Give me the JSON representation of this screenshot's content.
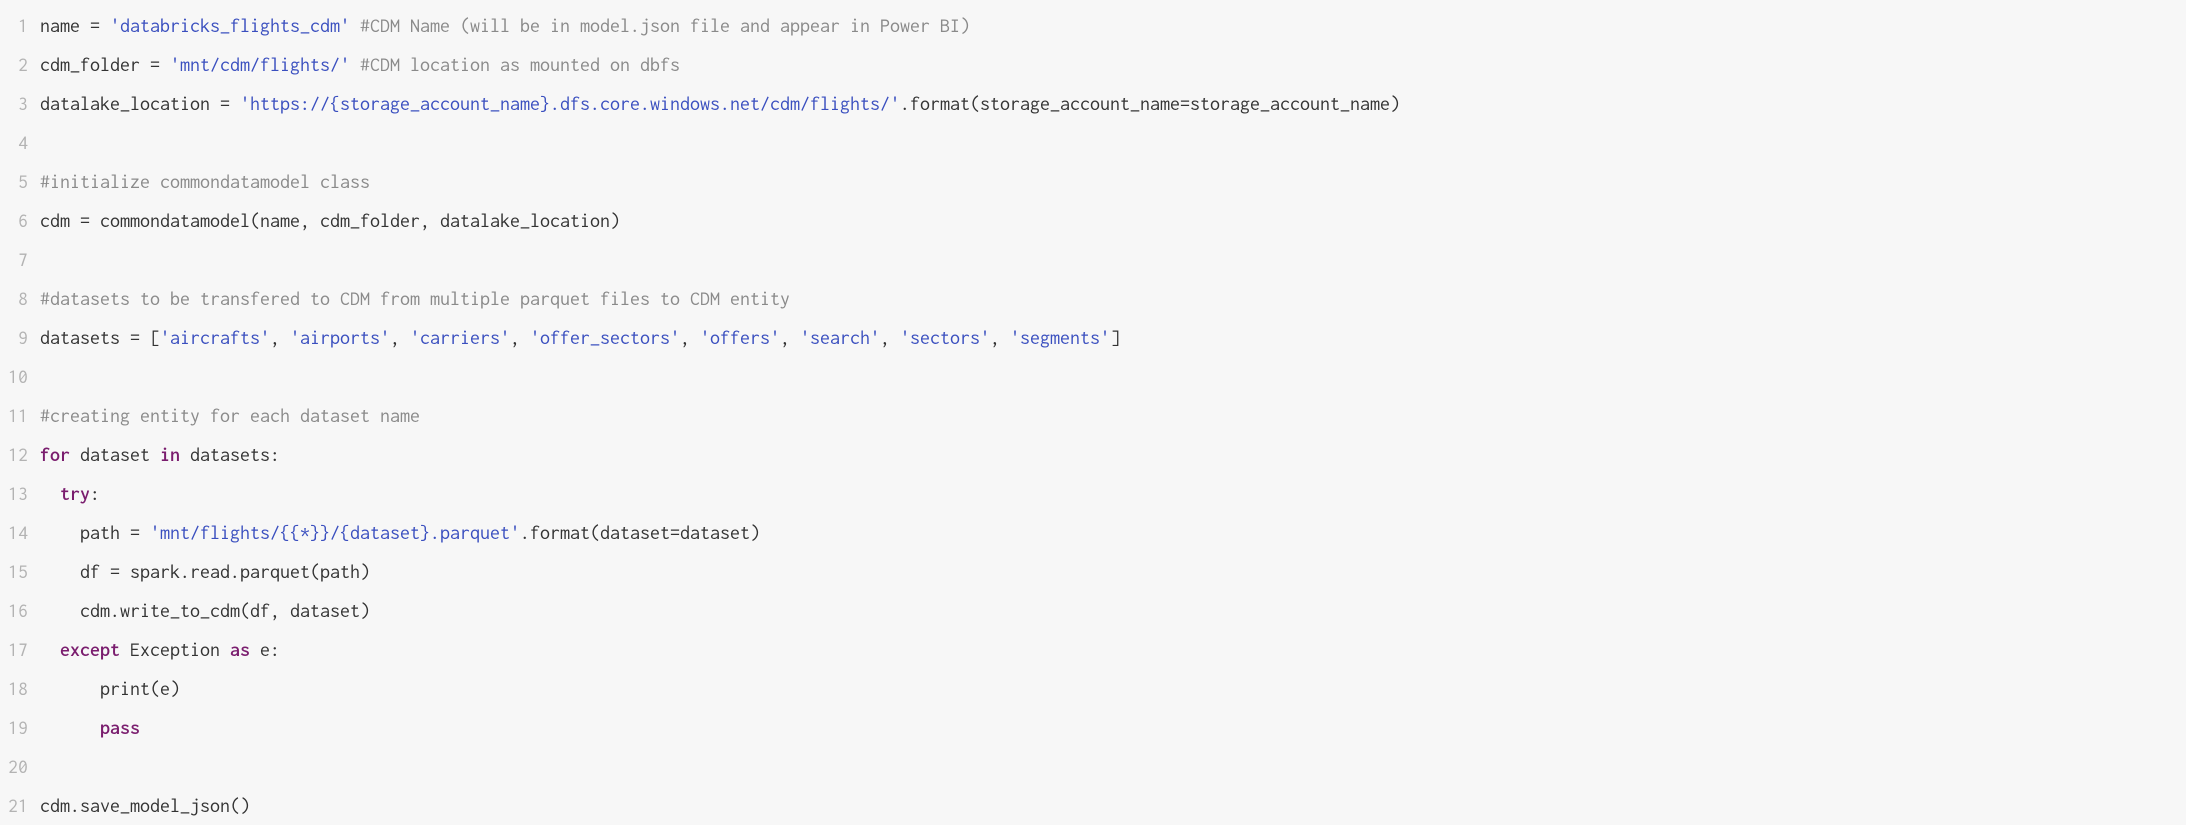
{
  "code": {
    "lines": [
      [
        {
          "c": "plain",
          "t": "name = "
        },
        {
          "c": "str",
          "t": "'databricks_flights_cdm'"
        },
        {
          "c": "plain",
          "t": " "
        },
        {
          "c": "comm",
          "t": "#CDM Name (will be in model.json file and appear in Power BI)"
        }
      ],
      [
        {
          "c": "plain",
          "t": "cdm_folder = "
        },
        {
          "c": "str",
          "t": "'mnt/cdm/flights/'"
        },
        {
          "c": "plain",
          "t": " "
        },
        {
          "c": "comm",
          "t": "#CDM location as mounted on dbfs"
        }
      ],
      [
        {
          "c": "plain",
          "t": "datalake_location = "
        },
        {
          "c": "str",
          "t": "'https://{storage_account_name}.dfs.core.windows.net/cdm/flights/'"
        },
        {
          "c": "plain",
          "t": ".format(storage_account_name=storage_account_name)"
        }
      ],
      [],
      [
        {
          "c": "comm",
          "t": "#initialize commondatamodel class"
        }
      ],
      [
        {
          "c": "plain",
          "t": "cdm = commondatamodel(name, cdm_folder, datalake_location)"
        }
      ],
      [],
      [
        {
          "c": "comm",
          "t": "#datasets to be transfered to CDM from multiple parquet files to CDM entity"
        }
      ],
      [
        {
          "c": "plain",
          "t": "datasets = ["
        },
        {
          "c": "str",
          "t": "'aircrafts'"
        },
        {
          "c": "plain",
          "t": ", "
        },
        {
          "c": "str",
          "t": "'airports'"
        },
        {
          "c": "plain",
          "t": ", "
        },
        {
          "c": "str",
          "t": "'carriers'"
        },
        {
          "c": "plain",
          "t": ", "
        },
        {
          "c": "str",
          "t": "'offer_sectors'"
        },
        {
          "c": "plain",
          "t": ", "
        },
        {
          "c": "str",
          "t": "'offers'"
        },
        {
          "c": "plain",
          "t": ", "
        },
        {
          "c": "str",
          "t": "'search'"
        },
        {
          "c": "plain",
          "t": ", "
        },
        {
          "c": "str",
          "t": "'sectors'"
        },
        {
          "c": "plain",
          "t": ", "
        },
        {
          "c": "str",
          "t": "'segments'"
        },
        {
          "c": "plain",
          "t": "]"
        }
      ],
      [],
      [
        {
          "c": "comm",
          "t": "#creating entity for each dataset name"
        }
      ],
      [
        {
          "c": "kw",
          "t": "for"
        },
        {
          "c": "plain",
          "t": " dataset "
        },
        {
          "c": "kw",
          "t": "in"
        },
        {
          "c": "plain",
          "t": " datasets:"
        }
      ],
      [
        {
          "c": "plain",
          "t": "  "
        },
        {
          "c": "kw",
          "t": "try"
        },
        {
          "c": "plain",
          "t": ":"
        }
      ],
      [
        {
          "c": "plain",
          "t": "    path = "
        },
        {
          "c": "str",
          "t": "'mnt/flights/{{*}}/{dataset}.parquet'"
        },
        {
          "c": "plain",
          "t": ".format(dataset=dataset)"
        }
      ],
      [
        {
          "c": "plain",
          "t": "    df = spark.read.parquet(path)"
        }
      ],
      [
        {
          "c": "plain",
          "t": "    cdm.write_to_cdm(df, dataset)"
        }
      ],
      [
        {
          "c": "plain",
          "t": "  "
        },
        {
          "c": "kw",
          "t": "except"
        },
        {
          "c": "plain",
          "t": " Exception "
        },
        {
          "c": "kw",
          "t": "as"
        },
        {
          "c": "plain",
          "t": " e:"
        }
      ],
      [
        {
          "c": "plain",
          "t": "      print(e)"
        }
      ],
      [
        {
          "c": "plain",
          "t": "      "
        },
        {
          "c": "kw",
          "t": "pass"
        }
      ],
      [],
      [
        {
          "c": "plain",
          "t": "cdm.save_model_json()"
        }
      ]
    ]
  }
}
